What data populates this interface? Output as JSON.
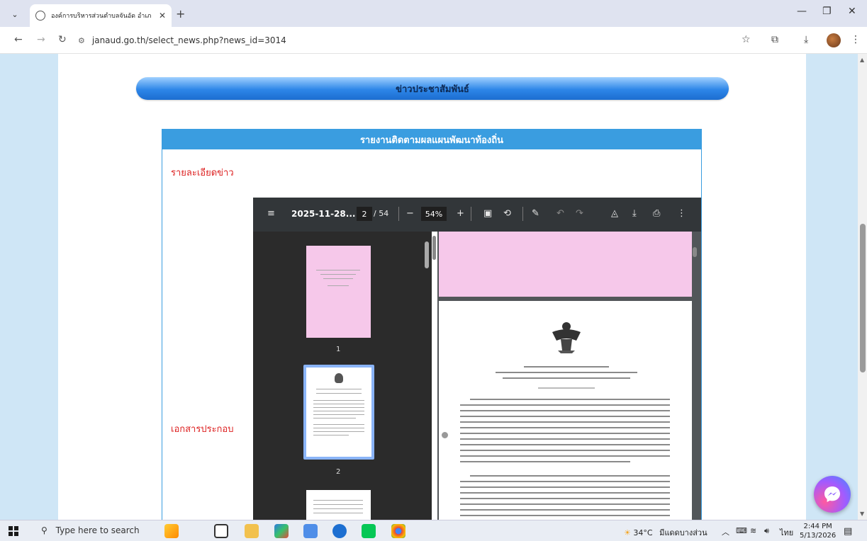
{
  "browser": {
    "tab_title": "องค์การบริหารส่วนตำบลจันอัด อำเภ",
    "url": "janaud.go.th/select_news.php?news_id=3014"
  },
  "page": {
    "banner_title": "ข่าวประชาสัมพันธ์",
    "panel_title": "รายงานติดตามผลแผนพัฒนาท้องถิ่น",
    "detail_label": "รายละเอียดข่าว",
    "attachments_label": "เอกสารประกอบ"
  },
  "pdf_viewer": {
    "file_name": "2025-11-28...",
    "current_page": "2",
    "page_total": "/ 54",
    "zoom": "54%",
    "thumbnails": [
      {
        "number": "1"
      },
      {
        "number": "2"
      }
    ]
  },
  "taskbar": {
    "search_placeholder": "Type here to search",
    "weather": "34°C",
    "weather_text": "มีแดดบางส่วน",
    "lang": "ไทย",
    "time": "2:44 PM",
    "date": "5/13/2026"
  },
  "colors": {
    "page_bg": "#cfe6f6",
    "banner_blue": "#2d86e8",
    "panel_header": "#3a9de0",
    "label_red": "#d22222",
    "pdf_toolbar": "#323639"
  }
}
